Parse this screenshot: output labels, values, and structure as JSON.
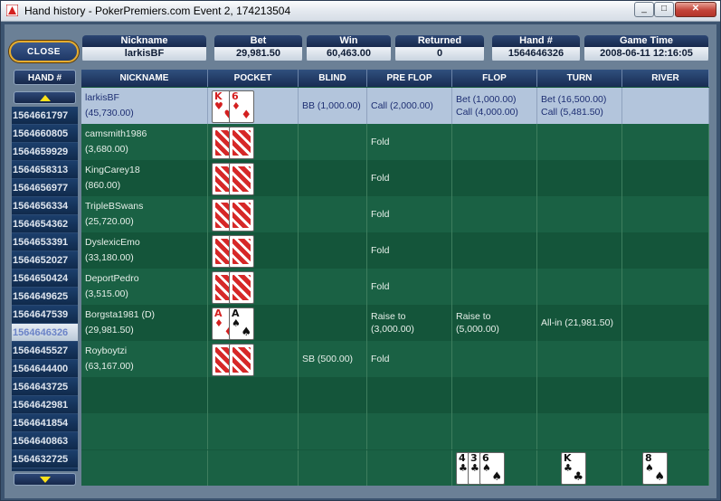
{
  "window": {
    "title": "Hand history - PokerPremiers.com Event 2, 174213504"
  },
  "close_button": {
    "label": "CLOSE"
  },
  "summary": [
    {
      "label": "Nickname",
      "value": "larkisBF"
    },
    {
      "label": "Bet",
      "value": "29,981.50"
    },
    {
      "label": "Win",
      "value": "60,463.00"
    },
    {
      "label": "Returned",
      "value": "0"
    },
    {
      "label": "Hand #",
      "value": "1564646326"
    },
    {
      "label": "Game Time",
      "value": "2008-06-11 12:16:05"
    }
  ],
  "hand_column": {
    "header": "HAND #",
    "selected": "1564646326",
    "items": [
      "1564661797",
      "1564660805",
      "1564659929",
      "1564658313",
      "1564656977",
      "1564656334",
      "1564654362",
      "1564653391",
      "1564652027",
      "1564650424",
      "1564649625",
      "1564647539",
      "1564646326",
      "1564645527",
      "1564644400",
      "1564643725",
      "1564642981",
      "1564641854",
      "1564640863",
      "1564632725"
    ]
  },
  "table": {
    "columns": [
      "NICKNAME",
      "POCKET",
      "BLIND",
      "PRE FLOP",
      "FLOP",
      "TURN",
      "RIVER"
    ],
    "rows": [
      {
        "name": "larkisBF",
        "chips": "(45,730.00)",
        "cards": [
          {
            "rank": "K",
            "suit": "♥",
            "color": "red"
          },
          {
            "rank": "6",
            "suit": "♦",
            "color": "red"
          }
        ],
        "blind": "BB (1,000.00)",
        "preflop": [
          "Call (2,000.00)"
        ],
        "flop": [
          "Bet (1,000.00)",
          "Call (4,000.00)"
        ],
        "turn": [
          "Bet (16,500.00)",
          "Call (5,481.50)"
        ],
        "river": [],
        "highlight": true
      },
      {
        "name": "camsmith1986",
        "chips": "(3,680.00)",
        "cards": "back",
        "blind": "",
        "preflop": [
          "Fold"
        ],
        "flop": [],
        "turn": [],
        "river": []
      },
      {
        "name": "KingCarey18",
        "chips": "(860.00)",
        "cards": "back",
        "blind": "",
        "preflop": [
          "Fold"
        ],
        "flop": [],
        "turn": [],
        "river": []
      },
      {
        "name": "TripleBSwans",
        "chips": "(25,720.00)",
        "cards": "back",
        "blind": "",
        "preflop": [
          "Fold"
        ],
        "flop": [],
        "turn": [],
        "river": []
      },
      {
        "name": "DyslexicEmo",
        "chips": "(33,180.00)",
        "cards": "back",
        "blind": "",
        "preflop": [
          "Fold"
        ],
        "flop": [],
        "turn": [],
        "river": []
      },
      {
        "name": "DeportPedro",
        "chips": "(3,515.00)",
        "cards": "back",
        "blind": "",
        "preflop": [
          "Fold"
        ],
        "flop": [],
        "turn": [],
        "river": []
      },
      {
        "name": "Borgsta1981 (D)",
        "chips": "(29,981.50)",
        "cards": [
          {
            "rank": "A",
            "suit": "♦",
            "color": "red"
          },
          {
            "rank": "A",
            "suit": "♠",
            "color": "blk"
          }
        ],
        "blind": "",
        "preflop": [
          "Raise to",
          "(3,000.00)"
        ],
        "flop": [
          "Raise to",
          "(5,000.00)"
        ],
        "turn": [
          "All-in (21,981.50)"
        ],
        "river": []
      },
      {
        "name": "Royboytzi",
        "chips": "(63,167.00)",
        "cards": "back",
        "blind": "SB (500.00)",
        "preflop": [
          "Fold"
        ],
        "flop": [],
        "turn": [],
        "river": []
      }
    ]
  },
  "board": {
    "flop": [
      {
        "rank": "4",
        "suit": "♣",
        "color": "blk"
      },
      {
        "rank": "3",
        "suit": "♣",
        "color": "blk"
      },
      {
        "rank": "6",
        "suit": "♠",
        "color": "blk"
      }
    ],
    "turn": [
      {
        "rank": "K",
        "suit": "♣",
        "color": "blk"
      }
    ],
    "river": [
      {
        "rank": "8",
        "suit": "♠",
        "color": "blk"
      }
    ]
  }
}
